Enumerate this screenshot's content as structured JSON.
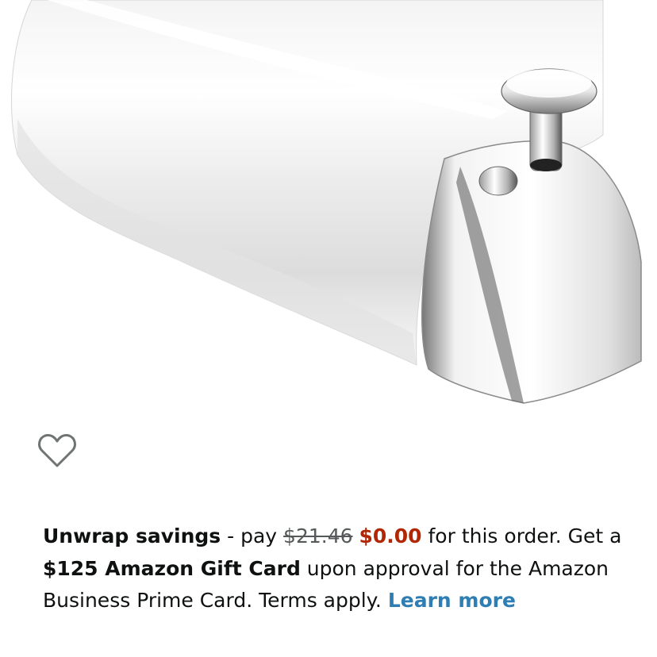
{
  "product": {
    "image_name": "tub-spout-chrome"
  },
  "wishlist": {
    "icon": "heart-outline-icon"
  },
  "promo": {
    "headline": "Unwrap savings",
    "dash_pay": " - pay ",
    "old_price": "$21.46",
    "space": " ",
    "new_price": "$0.00",
    "after_price": " for this order. Get a ",
    "gift_card": "$125 Amazon Gift Card",
    "after_gift": " upon approval for the Amazon Business Prime Card. Terms apply. ",
    "learn_more": "Learn more"
  },
  "colors": {
    "price_red": "#b12704",
    "link_blue": "#2e7eb4",
    "text": "#0f1111"
  }
}
